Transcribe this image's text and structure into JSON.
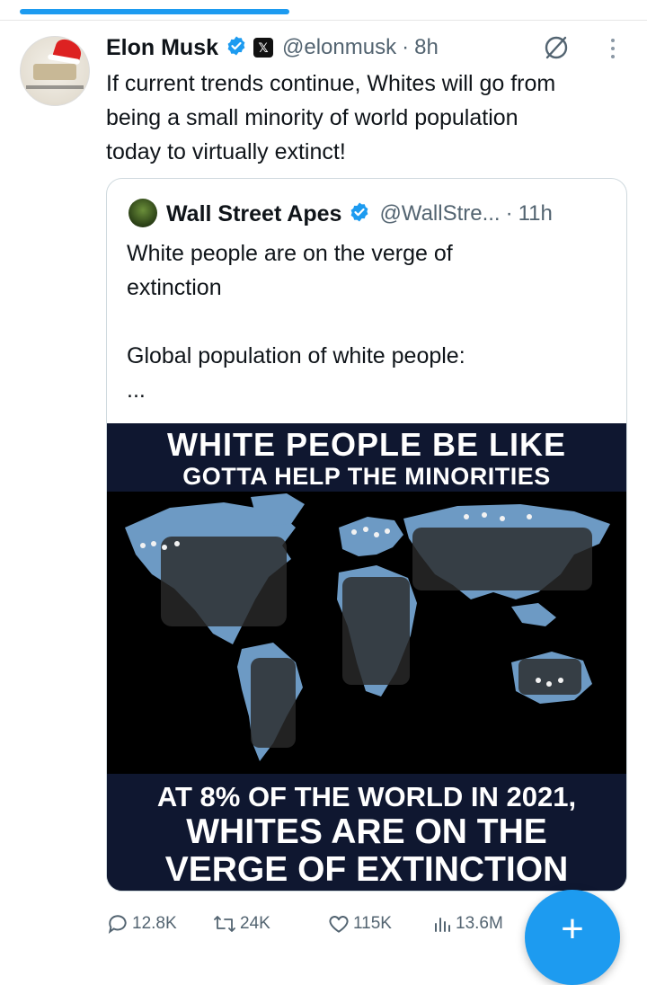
{
  "colors": {
    "accent": "#1d9bf0",
    "text": "#0f1419",
    "muted": "#536471",
    "meme_banner": "#0f1730",
    "map_land": "#6d9ac4"
  },
  "tweet": {
    "author_name": "Elon Musk",
    "author_handle": "@elonmusk",
    "time": "8h",
    "separator": "·",
    "text_lines": [
      "If current trends continue, Whites will go from",
      "being a small minority of world population",
      "today to virtually extinct!"
    ]
  },
  "quoted_tweet": {
    "author_name": "Wall Street Apes",
    "author_handle": "@WallStre...",
    "time": "11h",
    "separator": "·",
    "text_lines": [
      "White people are on the verge of",
      "extinction",
      "Global population of white people:",
      "..."
    ],
    "image": {
      "top_line_1": "WHITE PEOPLE BE LIKE",
      "top_line_2": "GOTTA HELP THE MINORITIES",
      "bottom_line_1": "AT 8% OF THE WORLD IN 2021,",
      "bottom_line_2": "WHITES ARE ON THE",
      "bottom_line_3": "VERGE OF EXTINCTION"
    }
  },
  "actions": {
    "replies": "12.8K",
    "reposts": "24K",
    "likes": "115K",
    "views": "13.6M"
  },
  "fab_label": "+",
  "icons": [
    "verified-badge-icon",
    "x-logo-icon",
    "grok-icon",
    "more-icon",
    "reply-icon",
    "repost-icon",
    "like-icon",
    "views-icon",
    "compose-icon"
  ]
}
